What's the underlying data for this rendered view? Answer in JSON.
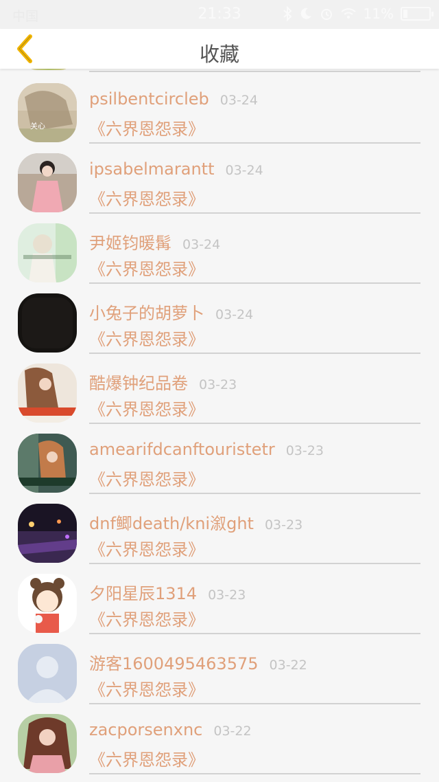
{
  "status_bar": {
    "carrier": "中国",
    "time": "21:33",
    "battery": "11%"
  },
  "header": {
    "title": "收藏",
    "back_icon": "chevron-left-icon"
  },
  "colors": {
    "accent": "#e0a07a",
    "back_icon": "#f0b400",
    "date": "#c4c4c4",
    "divider": "#d2d2d2"
  },
  "favorites": [
    {
      "name": "psilbentcircleb",
      "date": "03-24",
      "book": "《六界恩怨录》"
    },
    {
      "name": "ipsabelmarantt",
      "date": "03-24",
      "book": "《六界恩怨录》"
    },
    {
      "name": "尹姬钧暖髯",
      "date": "03-24",
      "book": "《六界恩怨录》"
    },
    {
      "name": "小兔子的胡萝卜",
      "date": "03-24",
      "book": "《六界恩怨录》"
    },
    {
      "name": "酷爆钟纪品卷",
      "date": "03-23",
      "book": "《六界恩怨录》"
    },
    {
      "name": "amearifdcanftouristetr",
      "date": "03-23",
      "book": "《六界恩怨录》"
    },
    {
      "name": "dnf鲫death/kni溆ght",
      "date": "03-23",
      "book": "《六界恩怨录》"
    },
    {
      "name": "夕阳星辰1314",
      "date": "03-23",
      "book": "《六界恩怨录》"
    },
    {
      "name": "游客1600495463575",
      "date": "03-22",
      "book": "《六界恩怨录》"
    },
    {
      "name": "zacporsenxnc",
      "date": "03-22",
      "book": "《六界恩怨录》"
    }
  ]
}
